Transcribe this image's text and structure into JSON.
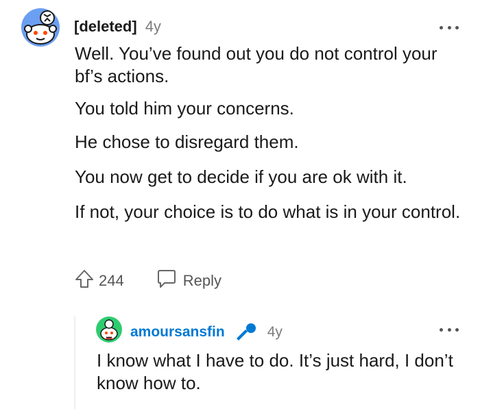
{
  "comment": {
    "author": "[deleted]",
    "age": "4y",
    "paragraphs": [
      "Well. You’ve found out you do not control your bf’s actions.",
      "You told him your concerns.",
      "He chose to disregard them.",
      "You now get to decide if you are ok with it.",
      "If not, your choice is to do what is in your control."
    ],
    "votes": "244",
    "reply_label": "Reply",
    "avatar_icon": "snoo-avatar-icon",
    "upvote_icon": "upvote-arrow-icon",
    "reply_icon": "speech-bubble-icon",
    "more_icon": "more-options-icon"
  },
  "reply": {
    "author": "amoursansfin",
    "age": "4y",
    "text": "I know what I have to do. It’s just hard, I don’t know how to.",
    "flair_icon": "microphone-icon",
    "avatar_icon": "snoo-avatar-icon",
    "more_icon": "more-options-icon",
    "author_color": "#0079d3",
    "flair_color": "#0079d3"
  }
}
